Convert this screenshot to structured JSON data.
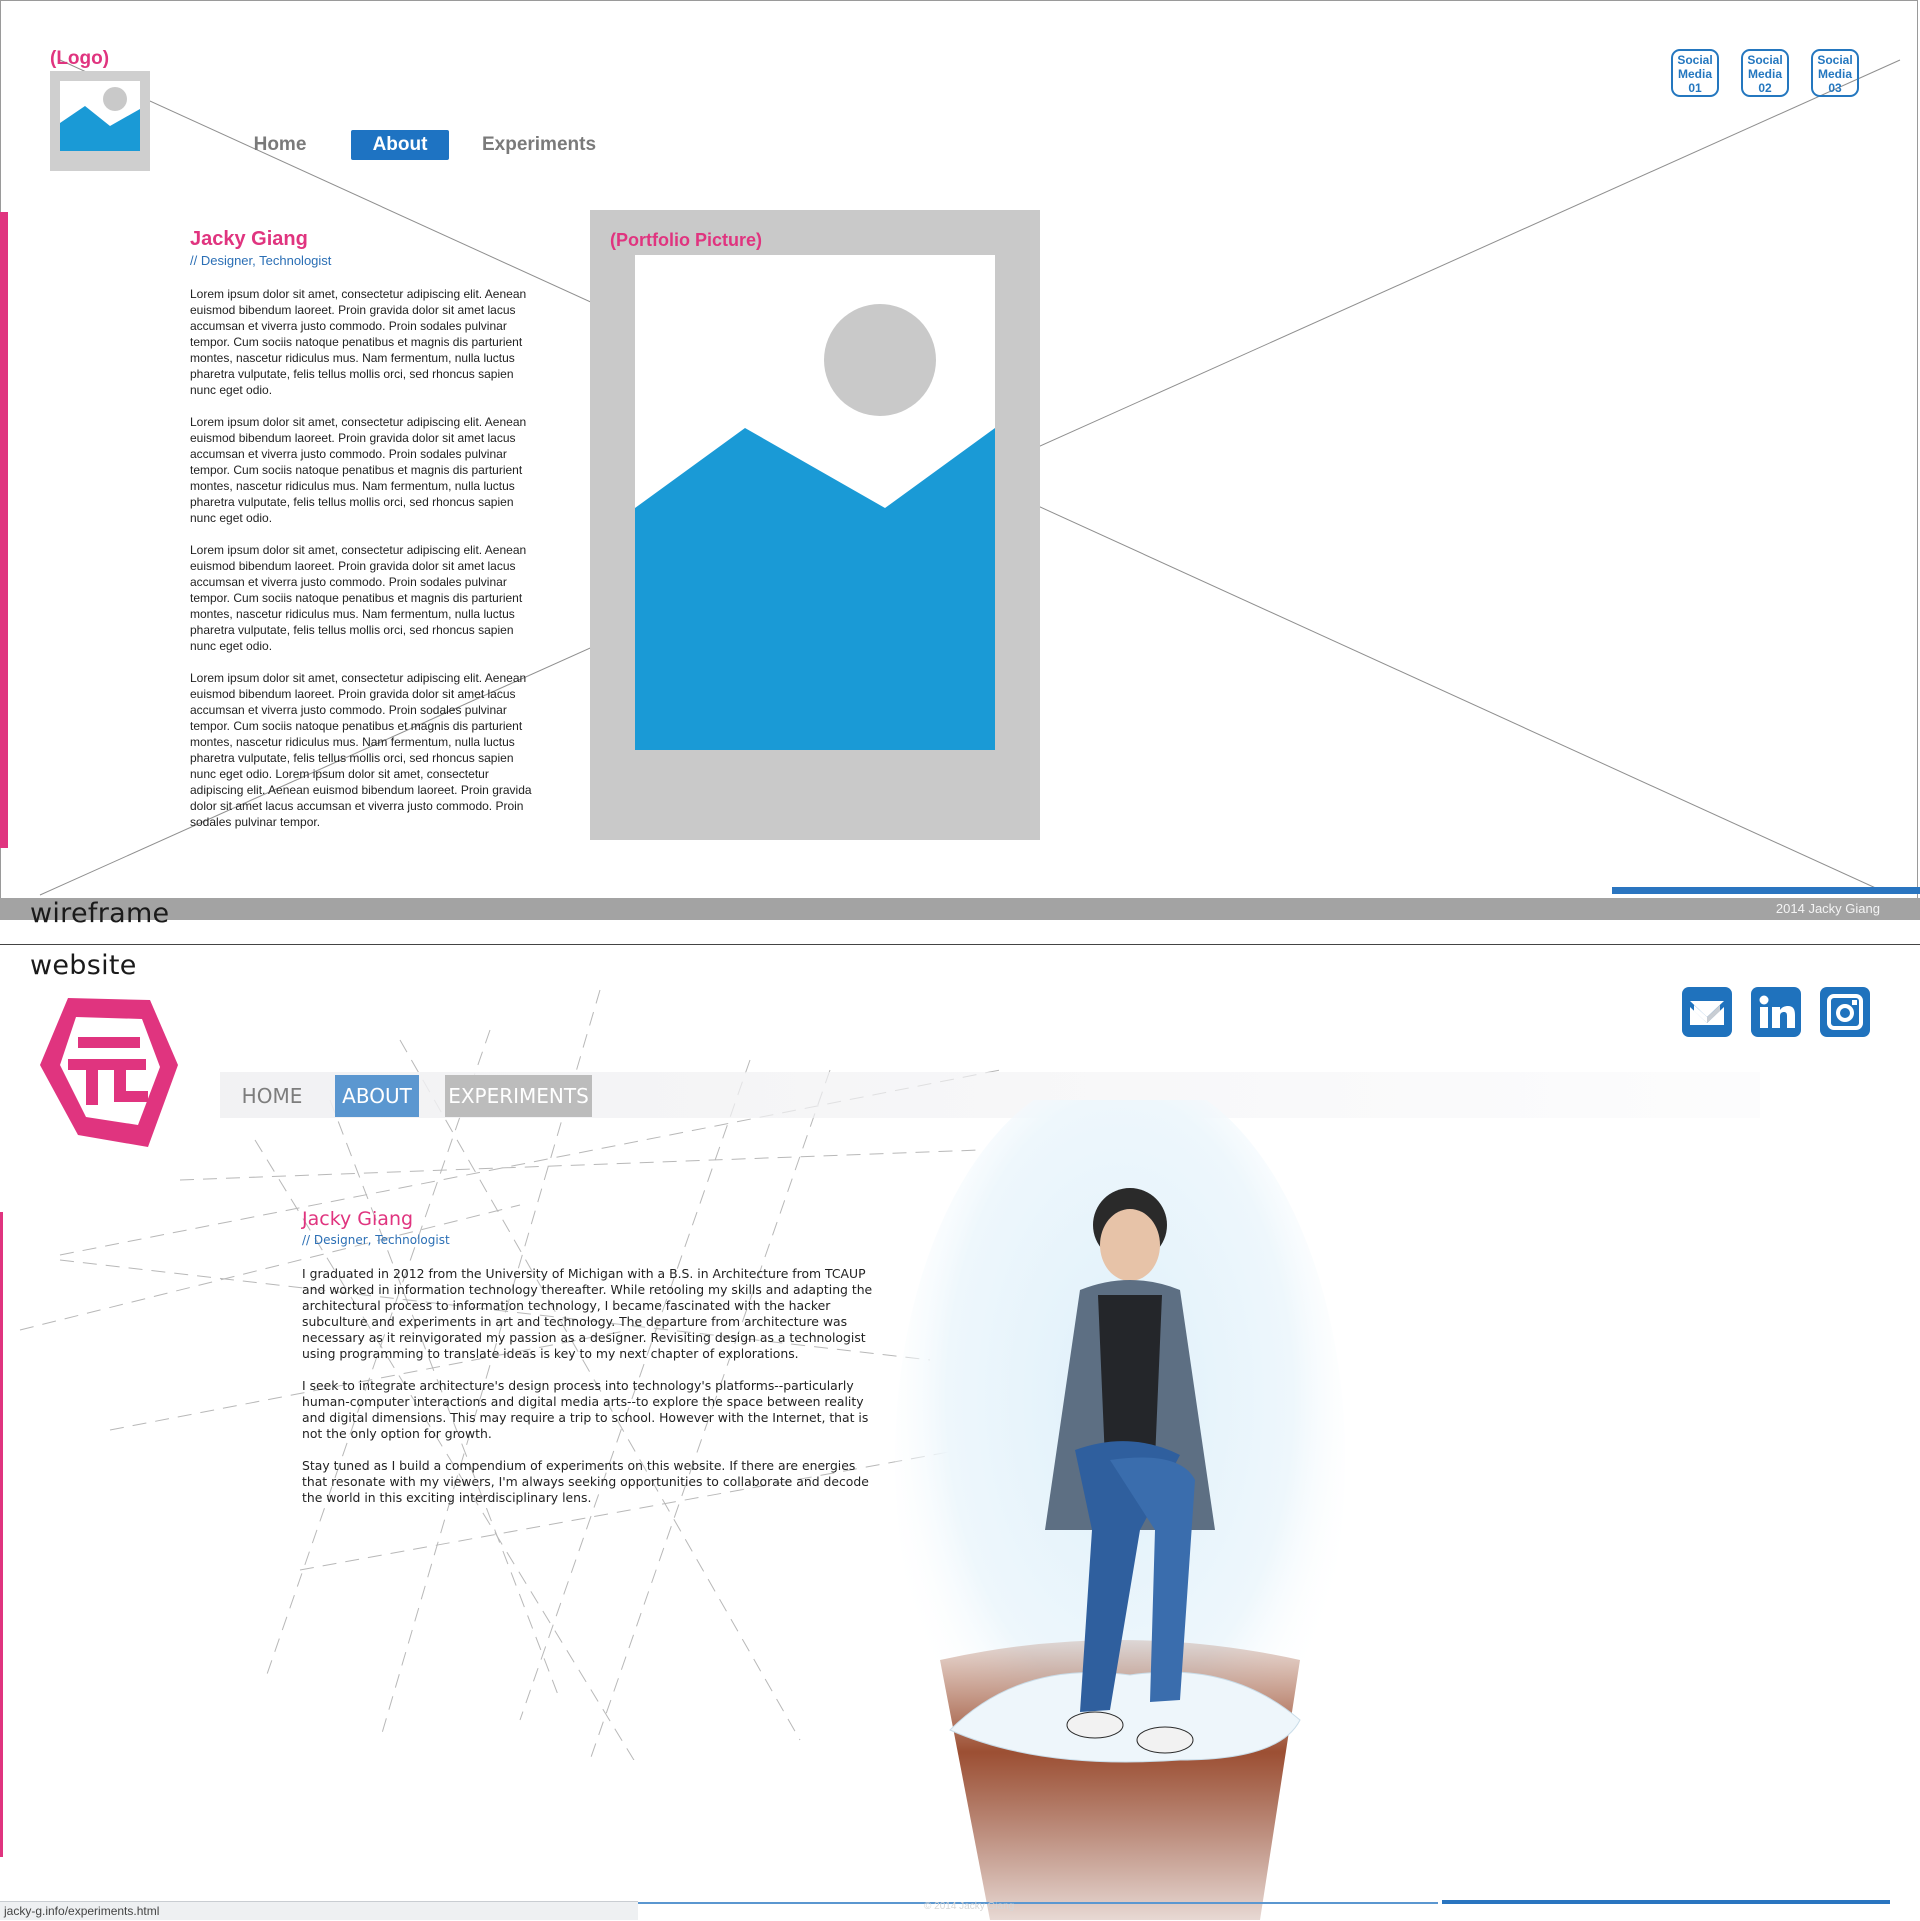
{
  "wireframe": {
    "logo_label": "(Logo)",
    "nav": [
      "Home",
      "About",
      "Experiments"
    ],
    "active_nav": "About",
    "social": [
      {
        "line1": "Social",
        "line2": "Media",
        "line3": "01"
      },
      {
        "line1": "Social",
        "line2": "Media",
        "line3": "02"
      },
      {
        "line1": "Social",
        "line2": "Media",
        "line3": "03"
      }
    ],
    "name": "Jacky Giang",
    "role": "// Designer, Technologist",
    "paragraphs": [
      "Lorem ipsum dolor sit amet, consectetur adipiscing elit. Aenean euismod bibendum laoreet. Proin gravida dolor sit amet lacus accumsan et viverra justo commodo. Proin sodales pulvinar tempor. Cum sociis natoque penatibus et magnis dis parturient montes, nascetur ridiculus mus. Nam fermentum, nulla luctus pharetra vulputate, felis tellus mollis orci, sed rhoncus sapien nunc eget odio.",
      "Lorem ipsum dolor sit amet, consectetur adipiscing elit. Aenean euismod bibendum laoreet. Proin gravida dolor sit amet lacus accumsan et viverra justo commodo. Proin sodales pulvinar tempor. Cum sociis natoque penatibus et magnis dis parturient montes, nascetur ridiculus mus. Nam fermentum, nulla luctus pharetra vulputate, felis tellus mollis orci, sed rhoncus sapien nunc eget odio.",
      "Lorem ipsum dolor sit amet, consectetur adipiscing elit. Aenean euismod bibendum laoreet. Proin gravida dolor sit amet lacus accumsan et viverra justo commodo. Proin sodales pulvinar tempor. Cum sociis natoque penatibus et magnis dis parturient montes, nascetur ridiculus mus. Nam fermentum, nulla luctus pharetra vulputate, felis tellus mollis orci, sed rhoncus sapien nunc eget odio.",
      "Lorem ipsum dolor sit amet, consectetur adipiscing elit. Aenean euismod bibendum laoreet. Proin gravida dolor sit amet lacus accumsan et viverra justo commodo. Proin sodales pulvinar tempor. Cum sociis natoque penatibus et magnis dis parturient montes, nascetur ridiculus mus. Nam fermentum, nulla luctus pharetra vulputate, felis tellus mollis orci, sed rhoncus sapien nunc eget odio. Lorem ipsum dolor sit amet, consectetur adipiscing elit. Aenean euismod bibendum laoreet. Proin gravida dolor sit amet lacus accumsan et viverra justo commodo. Proin sodales pulvinar tempor."
    ],
    "portfolio_label": "(Portfolio Picture)",
    "footer": "2014 Jacky Giang"
  },
  "labels": {
    "wireframe": "wireframe",
    "website": "website"
  },
  "website": {
    "nav": [
      "HOME",
      "ABOUT",
      "EXPERIMENTS"
    ],
    "active_nav": "ABOUT",
    "social_icons": [
      "mail-icon",
      "linkedin-icon",
      "instagram-icon"
    ],
    "name": "Jacky Giang",
    "role": "// Designer, Technologist",
    "paragraphs": [
      "I graduated in 2012 from the University of Michigan with a B.S. in Architecture from TCAUP and worked in information technology thereafter. While retooling my skills and adapting the architectural process to information technology, I became fascinated with the hacker subculture and experiments in art and technology. The departure from architecture was necessary as it reinvigorated my passion as a designer. Revisiting design as a technologist using programming to translate ideas is key to my next chapter of explorations.",
      "I seek to integrate architecture's design process into technology's platforms--particularly human-computer interactions and digital media arts--to explore the space between reality and digital dimensions. This may require a trip to school. However with the Internet, that is not the only option for growth.",
      "Stay tuned as I build a compendium of experiments on this website. If there are energies that resonate with my viewers, I'm always seeking opportunities to collaborate and decode the world in this exciting interdisciplinary lens."
    ],
    "footer": "© 2014 Jacky Giang",
    "status_url": "jacky-g.info/experiments.html"
  },
  "colors": {
    "accent_pink": "#e0347f",
    "brand_blue": "#1e73c2",
    "image_blue": "#1a9ad6",
    "placeholder_gray": "#c9c9c9"
  }
}
